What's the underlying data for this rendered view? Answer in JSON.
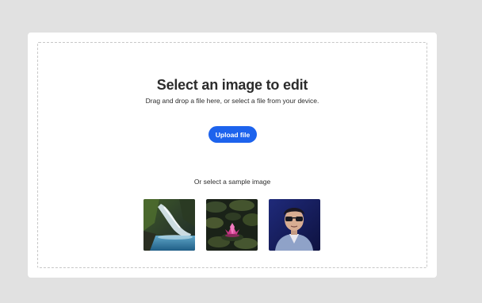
{
  "dropzone": {
    "title": "Select an image to edit",
    "subtitle": "Drag and drop a file here, or select a file from your device.",
    "upload_label": "Upload file",
    "sample_label": "Or select a sample image"
  },
  "samples": [
    {
      "name": "waterfall"
    },
    {
      "name": "water-lily"
    },
    {
      "name": "portrait"
    }
  ],
  "colors": {
    "page_bg": "#e1e1e1",
    "card_bg": "#ffffff",
    "accent": "#1d63ed",
    "text": "#2c2c2c"
  }
}
